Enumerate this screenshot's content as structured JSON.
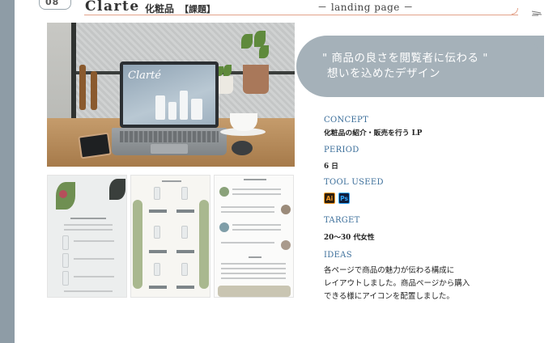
{
  "header": {
    "page_number": "08",
    "brand": "Clarte",
    "category": "化粧品",
    "note": "【課題】",
    "subtitle": "－ landing page －"
  },
  "hero": {
    "screen_logo": "Clarté"
  },
  "banner": {
    "line1": "\" 商品の良さを閲覧者に伝わる \"",
    "line2": "想いを込めたデザイン"
  },
  "info": {
    "concept_label": "CONCEPT",
    "concept_value": "化粧品の紹介・販売を行う LP",
    "period_label": "PERIOD",
    "period_value": "6 日",
    "tool_label": "TOOL USEED",
    "tools": [
      {
        "name": "Ai",
        "icon": "illustrator-icon",
        "color": "#f59b23"
      },
      {
        "name": "Ps",
        "icon": "photoshop-icon",
        "color": "#30a8ff"
      }
    ],
    "target_label": "TARGET",
    "target_value": "20～30 代女性",
    "ideas_label": "IDEAS",
    "ideas_lines": [
      "各ページで商品の魅力が伝わる構成に",
      "レイアウトしました。商品ページから購入",
      "できる様にアイコンを配置しました。"
    ]
  },
  "colors": {
    "accent_blue": "#3b6e9a",
    "banner_gray": "#a5b1b9",
    "sidebar_gray": "#8e9ca6",
    "line_orange": "#e3a38a"
  }
}
